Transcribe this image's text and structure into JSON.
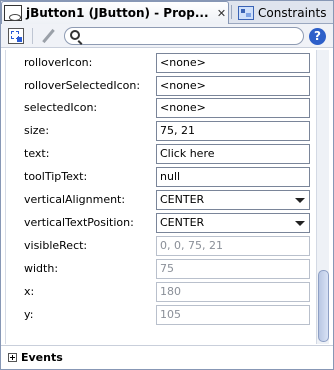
{
  "tabs": [
    {
      "label": "jButton1 (JButton) - Prop...",
      "active": true,
      "icon": "properties-icon",
      "close": "✕"
    },
    {
      "label": "Constraints",
      "active": false,
      "icon": "constraints-icon"
    }
  ],
  "toolbar": {
    "search_value": "",
    "help_label": "?"
  },
  "properties": [
    {
      "name": "rolloverIcon:",
      "value": "<none>",
      "type": "text",
      "enabled": true
    },
    {
      "name": "rolloverSelectedIcon:",
      "value": "<none>",
      "type": "text",
      "enabled": true
    },
    {
      "name": "selectedIcon:",
      "value": "<none>",
      "type": "text",
      "enabled": true
    },
    {
      "name": "size:",
      "value": "75, 21",
      "type": "text",
      "enabled": true
    },
    {
      "name": "text:",
      "value": "Click here",
      "type": "text",
      "enabled": true
    },
    {
      "name": "toolTipText:",
      "value": "null",
      "type": "text",
      "enabled": true
    },
    {
      "name": "verticalAlignment:",
      "value": "CENTER",
      "type": "combo",
      "enabled": true
    },
    {
      "name": "verticalTextPosition:",
      "value": "CENTER",
      "type": "combo",
      "enabled": true
    },
    {
      "name": "visibleRect:",
      "value": "0, 0, 75, 21",
      "type": "text",
      "enabled": false
    },
    {
      "name": "width:",
      "value": "75",
      "type": "text",
      "enabled": false
    },
    {
      "name": "x:",
      "value": "180",
      "type": "text",
      "enabled": false
    },
    {
      "name": "y:",
      "value": "105",
      "type": "text",
      "enabled": false
    }
  ],
  "events": {
    "label": "Events",
    "expanded": false
  },
  "colors": {
    "tab_active_bg": "#ffffff",
    "tab_strip_bg": "#dfe4ee",
    "help_blue": "#2d5fc9",
    "scroll_thumb": "#b9c7e3"
  }
}
